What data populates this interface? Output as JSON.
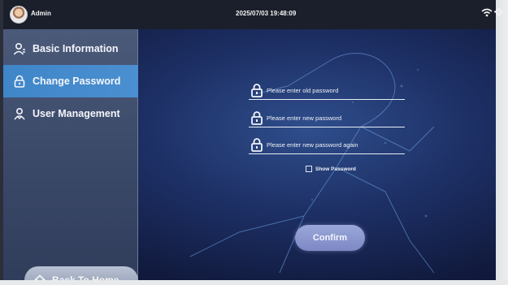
{
  "header": {
    "username": "Admin",
    "datetime": "2025/07/03 19:48:09",
    "status_icons": [
      "wifi-icon",
      "gear-icon"
    ]
  },
  "sidebar": {
    "items": [
      {
        "label": "Basic Information",
        "icon": "person-icon",
        "active": false
      },
      {
        "label": "Change Password",
        "icon": "lock-icon",
        "active": true
      },
      {
        "label": "User Management",
        "icon": "users-icon",
        "active": false
      }
    ],
    "back_label": "Back To Home"
  },
  "form": {
    "old_password": {
      "placeholder": "Please enter old password",
      "value": ""
    },
    "new_password": {
      "placeholder": "Please enter new password",
      "value": ""
    },
    "confirm_password": {
      "placeholder": "Please enter new password again",
      "value": ""
    },
    "show_password": {
      "label": "Show Password",
      "checked": false
    },
    "confirm_label": "Confirm"
  },
  "colors": {
    "active_nav": "#3f86c9",
    "confirm_button": "#8f9bd2",
    "topbar": "#1a1f2b"
  }
}
